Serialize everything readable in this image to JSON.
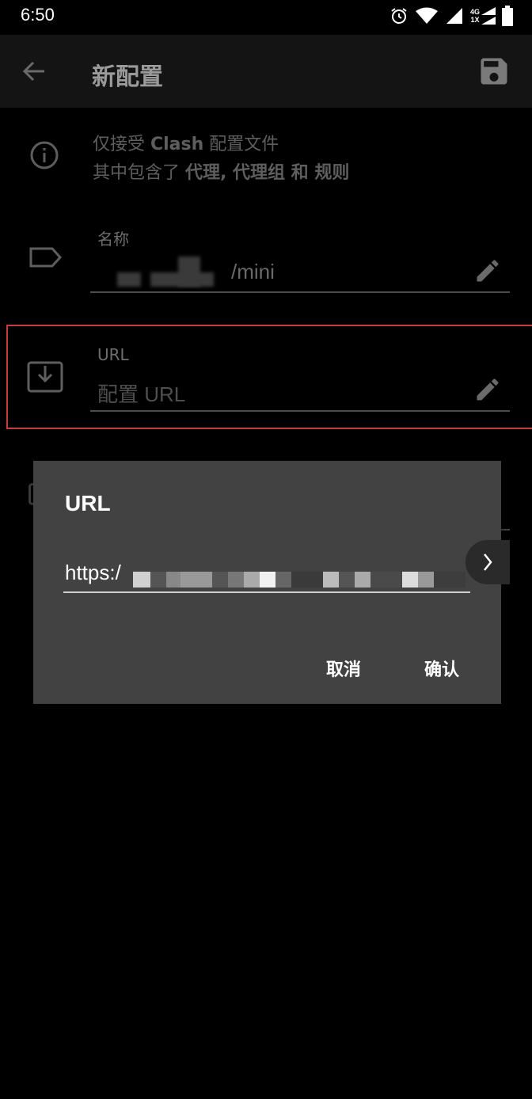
{
  "status_bar": {
    "time": "6:50",
    "network_top": "4G",
    "network_bottom": "1X",
    "icons": [
      "alarm-icon",
      "wifi-icon",
      "signal-icon",
      "signal-4g-icon",
      "battery-icon"
    ]
  },
  "app_bar": {
    "title": "新配置",
    "back_icon": "arrow-left-icon",
    "save_icon": "save-icon"
  },
  "info": {
    "line1_prefix": "仅接受 ",
    "line1_bold": "Clash",
    "line1_suffix": " 配置文件",
    "line2_prefix": "其中包含了 ",
    "line2_bold": "代理, 代理组 和 规则"
  },
  "name_field": {
    "label": "名称",
    "value_suffix": "/mini"
  },
  "url_field": {
    "label": "URL",
    "placeholder": "配置 URL"
  },
  "dialog": {
    "title": "URL",
    "input_value": "https:/",
    "cancel_label": "取消",
    "confirm_label": "确认"
  },
  "colors": {
    "highlight_border": "#c93c3c",
    "dialog_bg": "#424242",
    "app_bar_bg": "#141414"
  }
}
